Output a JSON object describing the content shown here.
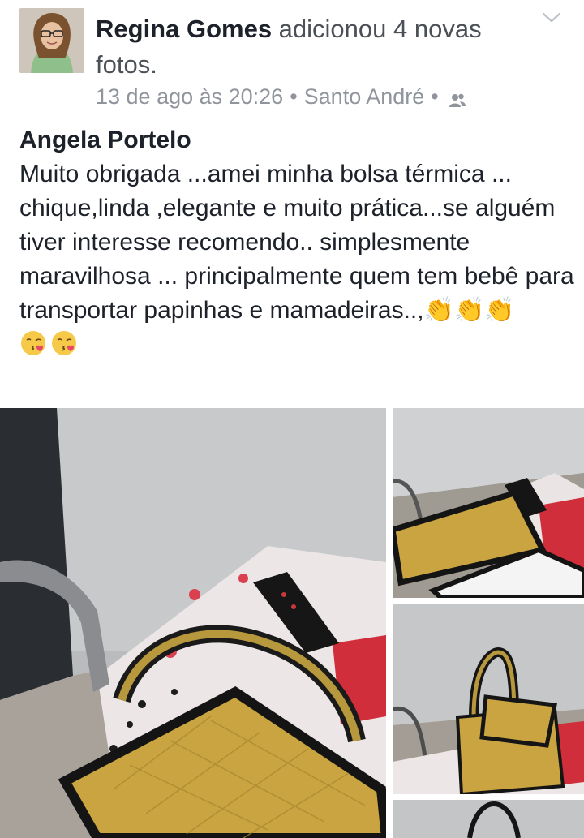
{
  "post": {
    "author": "Regina Gomes",
    "action": " adicionou 4 novas fotos.",
    "date": "13 de ago às 20:26",
    "separator": "•",
    "location": "Santo André",
    "audience_icon": "friends-icon",
    "menu_icon": "chevron-down-icon"
  },
  "comment": {
    "author": "Angela Portelo",
    "text": "Muito obrigada ...amei minha bolsa térmica ... chique,linda ,elegante e muito prática...se alguém tiver interesse recomendo.. simplesmente maravilhosa ... principalmente quem tem bebê para transportar papinhas e mamadeiras..,",
    "clap_emoji": "👏👏👏",
    "emoji_icons": [
      "kissing-face-icon",
      "kissing-face-icon"
    ]
  },
  "photos": {
    "count": 4,
    "items": [
      "photo-main",
      "photo-2",
      "photo-3",
      "photo-4"
    ]
  },
  "colors": {
    "text": "#1d2129",
    "secondary": "#90949c",
    "gold": "#c9a441",
    "black_trim": "#1a1a1a"
  }
}
